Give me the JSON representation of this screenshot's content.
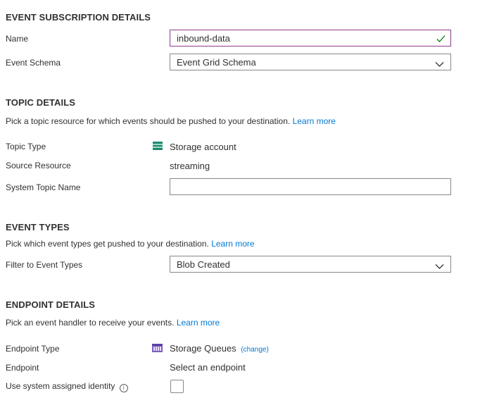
{
  "event_subscription": {
    "title": "EVENT SUBSCRIPTION DETAILS",
    "name_label": "Name",
    "name_value": "inbound-data",
    "schema_label": "Event Schema",
    "schema_value": "Event Grid Schema"
  },
  "topic": {
    "title": "TOPIC DETAILS",
    "description": "Pick a topic resource for which events should be pushed to your destination.",
    "learn_more": "Learn more",
    "type_label": "Topic Type",
    "type_value": "Storage account",
    "type_icon": "storage-account-icon",
    "source_label": "Source Resource",
    "source_value": "streaming",
    "system_topic_label": "System Topic Name",
    "system_topic_value": ""
  },
  "event_types": {
    "title": "EVENT TYPES",
    "description": "Pick which event types get pushed to your destination.",
    "learn_more": "Learn more",
    "filter_label": "Filter to Event Types",
    "filter_value": "Blob Created"
  },
  "endpoint": {
    "title": "ENDPOINT DETAILS",
    "description": "Pick an event handler to receive your events.",
    "learn_more": "Learn more",
    "type_label": "Endpoint Type",
    "type_value": "Storage Queues",
    "type_icon": "storage-queue-icon",
    "change_label": "(change)",
    "endpoint_label": "Endpoint",
    "endpoint_link": "Select an endpoint",
    "identity_label": "Use system assigned identity",
    "identity_info_glyph": "i",
    "identity_checked": false
  },
  "colors": {
    "link": "#0078d4",
    "focus_border": "#8b3a8f",
    "valid_check": "#107c10",
    "border": "#8a8886"
  }
}
